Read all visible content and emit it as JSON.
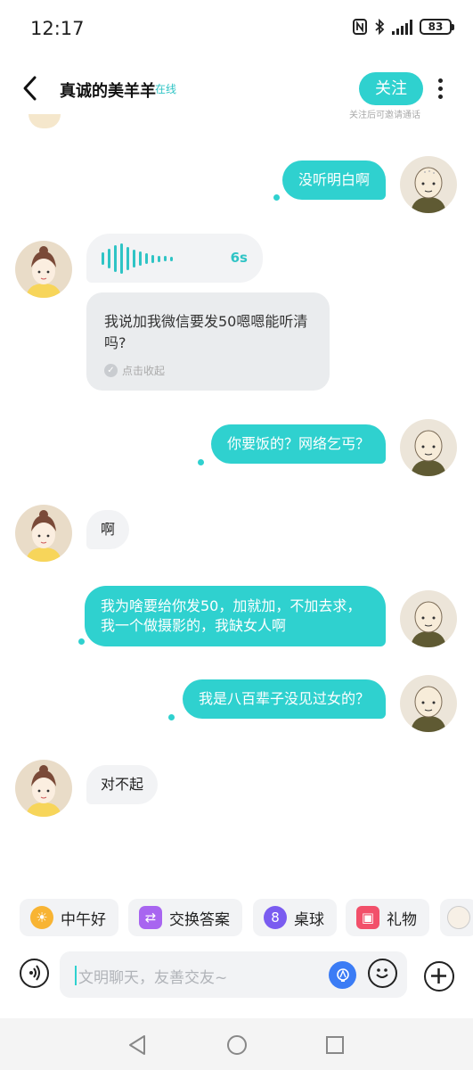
{
  "status_bar": {
    "time": "12:17",
    "battery": "83",
    "icons": [
      "nfc-icon",
      "bluetooth-icon",
      "signal-icon",
      "battery-icon"
    ]
  },
  "header": {
    "name": "真诚的美羊羊",
    "status": "在线",
    "follow_label": "关注",
    "follow_hint": "关注后可邀请通话"
  },
  "messages": [
    {
      "side": "out",
      "text": "没听明白啊"
    },
    {
      "side": "in",
      "type": "voice",
      "duration": "6s",
      "transcript": "我说加我微信要发50嗯嗯能听清吗?",
      "collapse_label": "点击收起"
    },
    {
      "side": "out",
      "text": "你要饭的？网络乞丐？"
    },
    {
      "side": "in",
      "text": "啊"
    },
    {
      "side": "out",
      "text": "我为啥要给你发50，加就加，不加去求，我一个做摄影的，我缺女人啊"
    },
    {
      "side": "out",
      "text": "我是八百辈子没见过女的？"
    },
    {
      "side": "in",
      "text": "对不起"
    }
  ],
  "quick_chips": [
    {
      "label": "中午好",
      "icon": "sun-icon"
    },
    {
      "label": "交换答案",
      "icon": "swap-icon"
    },
    {
      "label": "桌球",
      "icon": "billiard-ball-icon"
    },
    {
      "label": "礼物",
      "icon": "gift-icon"
    }
  ],
  "input": {
    "placeholder": "文明聊天，友善交友~"
  },
  "colors": {
    "accent": "#2fd1cf",
    "incoming_bubble": "#f2f3f5",
    "voice_wave": "#2fc4c5"
  }
}
